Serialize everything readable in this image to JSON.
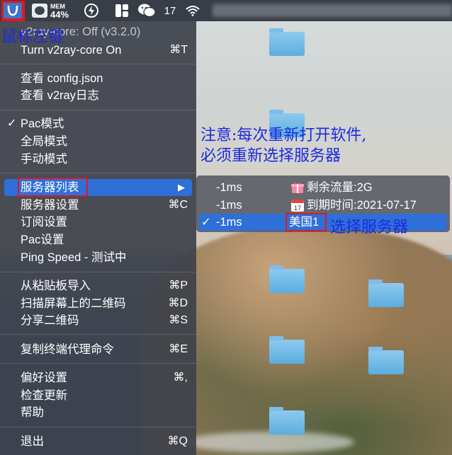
{
  "menubar": {
    "mem_label": "MEM",
    "mem_value": "44%",
    "notification_count": "17"
  },
  "main_menu": {
    "status": "v2ray-core: Off  (v3.2.0)",
    "turn_on": {
      "label": "Turn v2ray-core On",
      "shortcut": "⌘T"
    },
    "view_config": "查看 config.json",
    "view_log": "查看 v2ray日志",
    "pac_mode": "Pac模式",
    "global_mode": "全局模式",
    "manual_mode": "手动模式",
    "server_list": "服务器列表",
    "server_settings": {
      "label": "服务器设置",
      "shortcut": "⌘C"
    },
    "subscribe_settings": "订阅设置",
    "pac_settings": "Pac设置",
    "ping_speed": "Ping Speed - 测试中",
    "import_clipboard": {
      "label": "从粘贴板导入",
      "shortcut": "⌘P"
    },
    "scan_qr": {
      "label": "扫描屏幕上的二维码",
      "shortcut": "⌘D"
    },
    "share_qr": {
      "label": "分享二维码",
      "shortcut": "⌘S"
    },
    "copy_proxy_cmd": {
      "label": "复制终端代理命令",
      "shortcut": "⌘E"
    },
    "preferences": {
      "label": "偏好设置",
      "shortcut": "⌘,"
    },
    "check_updates": "检查更新",
    "help": "帮助",
    "quit": {
      "label": "退出",
      "shortcut": "⌘Q"
    },
    "check_glyph": "✓",
    "submenu_arrow": "▶"
  },
  "submenu": {
    "items": [
      {
        "ping": "-1ms",
        "name": "剩余流量:2G",
        "icon": "gift-icon",
        "selected": false
      },
      {
        "ping": "-1ms",
        "name": "到期时间:2021-07-17",
        "icon": "calendar-icon",
        "calendar_day": "17",
        "selected": false
      },
      {
        "ping": "-1ms",
        "name": "美国1",
        "icon": "",
        "selected": true
      }
    ]
  },
  "annotations": {
    "left_click": "鼠标左键",
    "notice_line1": "注意:每次重新打开软件,",
    "notice_line2": "必须重新选择服务器",
    "choose_server": "选择服务器"
  },
  "colors": {
    "highlight": "#2f6fd8",
    "annotation_text": "#1f2ae0",
    "annotation_box": "#e1171e"
  }
}
